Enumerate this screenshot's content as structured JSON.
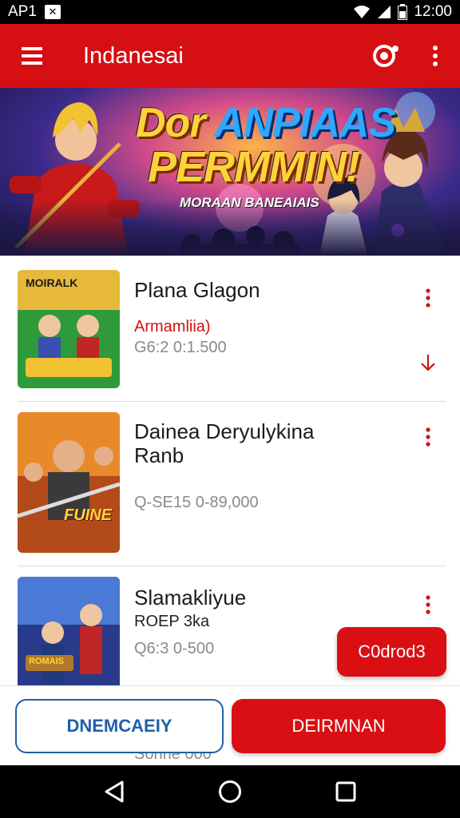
{
  "status_bar": {
    "left_text": "AP1",
    "time": "12:00"
  },
  "app_bar": {
    "title": "Indanesai"
  },
  "banner": {
    "headline_part1": "Dor ",
    "headline_part2": "ANPIAAS",
    "headline_line2": "PERMMIN!",
    "subheadline": "MORAAN BANEAIAIS"
  },
  "items": [
    {
      "name": "Plana Glagon",
      "subtitle": "Armamliia)",
      "price": "G6:2 0:1.500",
      "thumb_text": "MOIRALK"
    },
    {
      "name": "Dainea  Deryulykina\nRanb",
      "subtitle": "",
      "price": "Q-SE15 0-89,000",
      "thumb_text": "FUINE"
    },
    {
      "name": "Slamakliyue",
      "subtitle": "ROEP 3ka",
      "price": "Q6:3 0-500",
      "thumb_text": "ROMAIS"
    }
  ],
  "peek_text": "Sonne 000",
  "fab": {
    "label": "C0drod3"
  },
  "buttons": {
    "secondary": "DNEMCAEIY",
    "primary": "DEIRMNAN"
  },
  "colors": {
    "brand_red": "#d50f12",
    "outline_blue": "#1f5fa8"
  }
}
